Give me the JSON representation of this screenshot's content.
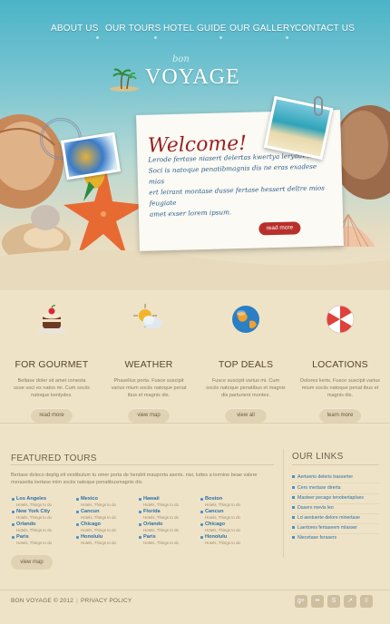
{
  "nav": {
    "items": [
      {
        "label": "ABOUT US"
      },
      {
        "label": "OUR TOURS"
      },
      {
        "label": "HOTEL GUIDE"
      },
      {
        "label": "OUR GALLERY"
      },
      {
        "label": "CONTACT US"
      }
    ]
  },
  "logo": {
    "top": "bon",
    "main": "VOYAGE"
  },
  "welcome": {
    "heading": "Welcome!",
    "lines": [
      "Lerode fertase niasert delertas kwertya leryades!",
      "Soci is natoque penatibmagnis dis ne eras exadese mias",
      "ert leirant montase dusse fertase hessert deltre mios feugiate",
      "amet exser lorem ipsum."
    ],
    "button": "read more"
  },
  "features": [
    {
      "icon": "cake-icon",
      "title": "FOR GOURMET",
      "desc": "Beltase doler sit amet conesta usse soci ex natos mi. Cum sociis natoque kentydes.",
      "button": "read more"
    },
    {
      "icon": "weather-icon",
      "title": "WEATHER",
      "desc": "Phasellus porta. Fusce suscipit varius mium sociis natoque penat ibus et magnis dis.",
      "button": "view map"
    },
    {
      "icon": "globe-icon",
      "title": "TOP DEALS",
      "desc": "Fusce suscipit varius mi. Cum sociis natoque penatibus et magnis dis parturient montes.",
      "button": "view all"
    },
    {
      "icon": "umbrella-icon",
      "title": "LOCATIONS",
      "desc": "Dolores kerts. Fusce suscipit varius mium sociis natoque penat ibus et magnis dis.",
      "button": "learn more"
    }
  ],
  "tours": {
    "title": "FEATURED TOURS",
    "intro": "Bertase doleco deplig elt vestibulum tu omer porta de hendrit mauporta aserts. nisi, luttes a lormine beae valere merasetta kertase mim sociis natoque penatibusmagnis dis.",
    "columns": [
      [
        {
          "name": "Los Angeles",
          "sub": "Hotels, Things to do"
        },
        {
          "name": "New York City",
          "sub": "Hotels, Things to do"
        },
        {
          "name": "Orlando",
          "sub": "Hotels, Things to do"
        },
        {
          "name": "Paris",
          "sub": "Hotels, Things to do"
        }
      ],
      [
        {
          "name": "Mexico",
          "sub": "Hotels, Things to do"
        },
        {
          "name": "Cancun",
          "sub": "Hotels, Things to do"
        },
        {
          "name": "Chicago",
          "sub": "Hotels, Things to do"
        },
        {
          "name": "Honolulu",
          "sub": "Hotels, Things to do"
        }
      ],
      [
        {
          "name": "Hawaii",
          "sub": "Hotels, Things to do"
        },
        {
          "name": "Florida",
          "sub": "Hotels, Things to do"
        },
        {
          "name": "Orlando",
          "sub": "Hotels, Things to do"
        },
        {
          "name": "Paris",
          "sub": "Hotels, Things to do"
        }
      ],
      [
        {
          "name": "Boston",
          "sub": "Hotels, Things to do"
        },
        {
          "name": "Cancun",
          "sub": "Hotels, Things to do"
        },
        {
          "name": "Chicago",
          "sub": "Hotels, Things to do"
        },
        {
          "name": "Honolulu",
          "sub": "Hotels, Things to do"
        }
      ]
    ],
    "button": "view map"
  },
  "links": {
    "title": "OUR LINKS",
    "items": [
      "Aertuerio deleris trasserter",
      "Cero mertase direrta",
      "Masteer pecage tenobertaplues",
      "Dasers mevis leo",
      "Ld aestuerte delore minertase",
      "Laertores fertaseem mlasser",
      "Niecetase ferasers"
    ]
  },
  "footer": {
    "copyright": "BON VOYAGE © 2012",
    "separator": "|",
    "privacy": "PRIVACY POLICY"
  },
  "social": [
    {
      "icon": "google-plus-icon",
      "glyph": "g+"
    },
    {
      "icon": "flickr-icon",
      "glyph": "••"
    },
    {
      "icon": "skype-icon",
      "glyph": "S"
    },
    {
      "icon": "share-icon",
      "glyph": "↗"
    },
    {
      "icon": "drop-icon",
      "glyph": "◊"
    }
  ],
  "colors": {
    "accent": "#b8302b",
    "link": "#2c6fa6",
    "sky": "#4bb4c8",
    "sand": "#efe3c7"
  }
}
